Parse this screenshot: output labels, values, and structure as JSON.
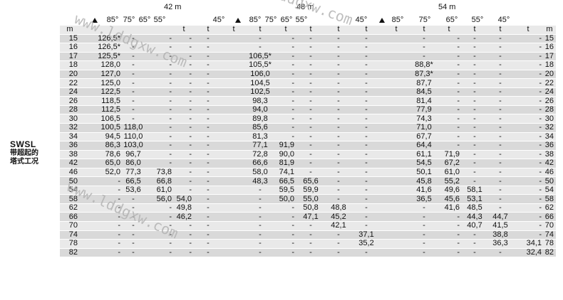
{
  "header": {
    "booms": [
      "42 m",
      "48 m",
      "54 m"
    ],
    "angles": [
      "85°",
      "75°",
      "65°",
      "55°",
      "45°",
      "85°",
      "75°",
      "65°",
      "55°",
      "45°",
      "85°",
      "75°",
      "65°",
      "55°",
      "45°"
    ]
  },
  "units": {
    "left_m": "m",
    "right_m": "m",
    "t": "t"
  },
  "side_label": {
    "line1": "SWSL",
    "line2": "带超起的",
    "line3": "塔式工况"
  },
  "rows": [
    {
      "m": "15",
      "v": [
        "126,5*",
        "-",
        "-",
        "-",
        "-",
        "-",
        "-",
        "-",
        "-",
        "-",
        "-",
        "-",
        "-",
        "-",
        "-"
      ]
    },
    {
      "m": "16",
      "v": [
        "126,5*",
        "-",
        "-",
        "-",
        "-",
        "-",
        "-",
        "-",
        "-",
        "-",
        "-",
        "-",
        "-",
        "-",
        "-"
      ]
    },
    {
      "m": "17",
      "v": [
        "125,5*",
        "-",
        "-",
        "-",
        "-",
        "106,5*",
        "-",
        "-",
        "-",
        "-",
        "-",
        "-",
        "-",
        "-",
        "-"
      ]
    },
    {
      "m": "18",
      "v": [
        "128,0",
        "-",
        "-",
        "-",
        "-",
        "105,5*",
        "-",
        "-",
        "-",
        "-",
        "88,8*",
        "-",
        "-",
        "-",
        "-"
      ]
    },
    {
      "m": "20",
      "v": [
        "127,0",
        "-",
        "-",
        "-",
        "-",
        "106,0",
        "-",
        "-",
        "-",
        "-",
        "87,3*",
        "-",
        "-",
        "-",
        "-"
      ]
    },
    {
      "m": "22",
      "v": [
        "125,0",
        "-",
        "-",
        "-",
        "-",
        "104,5",
        "-",
        "-",
        "-",
        "-",
        "87,7",
        "-",
        "-",
        "-",
        "-"
      ]
    },
    {
      "m": "24",
      "v": [
        "122,5",
        "-",
        "-",
        "-",
        "-",
        "102,5",
        "-",
        "-",
        "-",
        "-",
        "84,5",
        "-",
        "-",
        "-",
        "-"
      ]
    },
    {
      "m": "26",
      "v": [
        "118,5",
        "-",
        "-",
        "-",
        "-",
        "98,3",
        "-",
        "-",
        "-",
        "-",
        "81,4",
        "-",
        "-",
        "-",
        "-"
      ]
    },
    {
      "m": "28",
      "v": [
        "112,5",
        "-",
        "-",
        "-",
        "-",
        "94,0",
        "-",
        "-",
        "-",
        "-",
        "77,9",
        "-",
        "-",
        "-",
        "-"
      ]
    },
    {
      "m": "30",
      "v": [
        "106,5",
        "-",
        "-",
        "-",
        "-",
        "89,8",
        "-",
        "-",
        "-",
        "-",
        "74,3",
        "-",
        "-",
        "-",
        "-"
      ]
    },
    {
      "m": "32",
      "v": [
        "100,5",
        "118,0",
        "-",
        "-",
        "-",
        "85,6",
        "-",
        "-",
        "-",
        "-",
        "71,0",
        "-",
        "-",
        "-",
        "-"
      ]
    },
    {
      "m": "34",
      "v": [
        "94,5",
        "110,0",
        "-",
        "-",
        "-",
        "81,3",
        "-",
        "-",
        "-",
        "-",
        "67,7",
        "-",
        "-",
        "-",
        "-"
      ]
    },
    {
      "m": "36",
      "v": [
        "86,3",
        "103,0",
        "-",
        "-",
        "-",
        "77,1",
        "91,9",
        "-",
        "-",
        "-",
        "64,4",
        "-",
        "-",
        "-",
        "-"
      ]
    },
    {
      "m": "38",
      "v": [
        "78,6",
        "96,7",
        "-",
        "-",
        "-",
        "72,8",
        "90,0",
        "-",
        "-",
        "-",
        "61,1",
        "71,9",
        "-",
        "-",
        "-"
      ]
    },
    {
      "m": "42",
      "v": [
        "65,0",
        "86,0",
        "-",
        "-",
        "-",
        "66,6",
        "81,9",
        "-",
        "-",
        "-",
        "54,5",
        "67,2",
        "-",
        "-",
        "-"
      ]
    },
    {
      "m": "46",
      "v": [
        "52,0",
        "77,3",
        "73,8",
        "-",
        "-",
        "58,0",
        "74,1",
        "-",
        "-",
        "-",
        "50,1",
        "61,0",
        "-",
        "-",
        "-"
      ]
    },
    {
      "m": "50",
      "v": [
        "-",
        "66,5",
        "66,8",
        "-",
        "-",
        "48,3",
        "66,5",
        "65,6",
        "-",
        "-",
        "45,8",
        "55,2",
        "-",
        "-",
        "-"
      ]
    },
    {
      "m": "54",
      "v": [
        "-",
        "53,6",
        "61,0",
        "-",
        "-",
        "-",
        "59,5",
        "59,9",
        "-",
        "-",
        "41,6",
        "49,6",
        "58,1",
        "-",
        "-"
      ]
    },
    {
      "m": "58",
      "v": [
        "-",
        "-",
        "56,0",
        "54,0",
        "-",
        "-",
        "50,0",
        "55,0",
        "-",
        "-",
        "36,5",
        "45,6",
        "53,1",
        "-",
        "-"
      ]
    },
    {
      "m": "62",
      "v": [
        "-",
        "-",
        "-",
        "49,8",
        "-",
        "-",
        "-",
        "50,8",
        "48,8",
        "-",
        "-",
        "41,6",
        "48,5",
        "-",
        "-"
      ]
    },
    {
      "m": "66",
      "v": [
        "-",
        "-",
        "-",
        "46,2",
        "-",
        "-",
        "-",
        "47,1",
        "45,2",
        "-",
        "-",
        "-",
        "44,3",
        "44,7",
        "-"
      ]
    },
    {
      "m": "70",
      "v": [
        "-",
        "-",
        "-",
        "-",
        "-",
        "-",
        "-",
        "-",
        "42,1",
        "-",
        "-",
        "-",
        "40,7",
        "41,5",
        "-"
      ]
    },
    {
      "m": "74",
      "v": [
        "-",
        "-",
        "-",
        "-",
        "-",
        "-",
        "-",
        "-",
        "-",
        "37,1",
        "-",
        "-",
        "-",
        "38,8",
        "-"
      ]
    },
    {
      "m": "78",
      "v": [
        "-",
        "-",
        "-",
        "-",
        "-",
        "-",
        "-",
        "-",
        "-",
        "35,2",
        "-",
        "-",
        "-",
        "36,3",
        "34,1"
      ]
    },
    {
      "m": "82",
      "v": [
        "-",
        "-",
        "-",
        "-",
        "-",
        "-",
        "-",
        "-",
        "-",
        "-",
        "-",
        "-",
        "-",
        "-",
        "32,4"
      ]
    }
  ],
  "watermarks": [
    "www.lddgxw.com",
    "www.lddgxw.com",
    "www.lddgxw.com"
  ]
}
